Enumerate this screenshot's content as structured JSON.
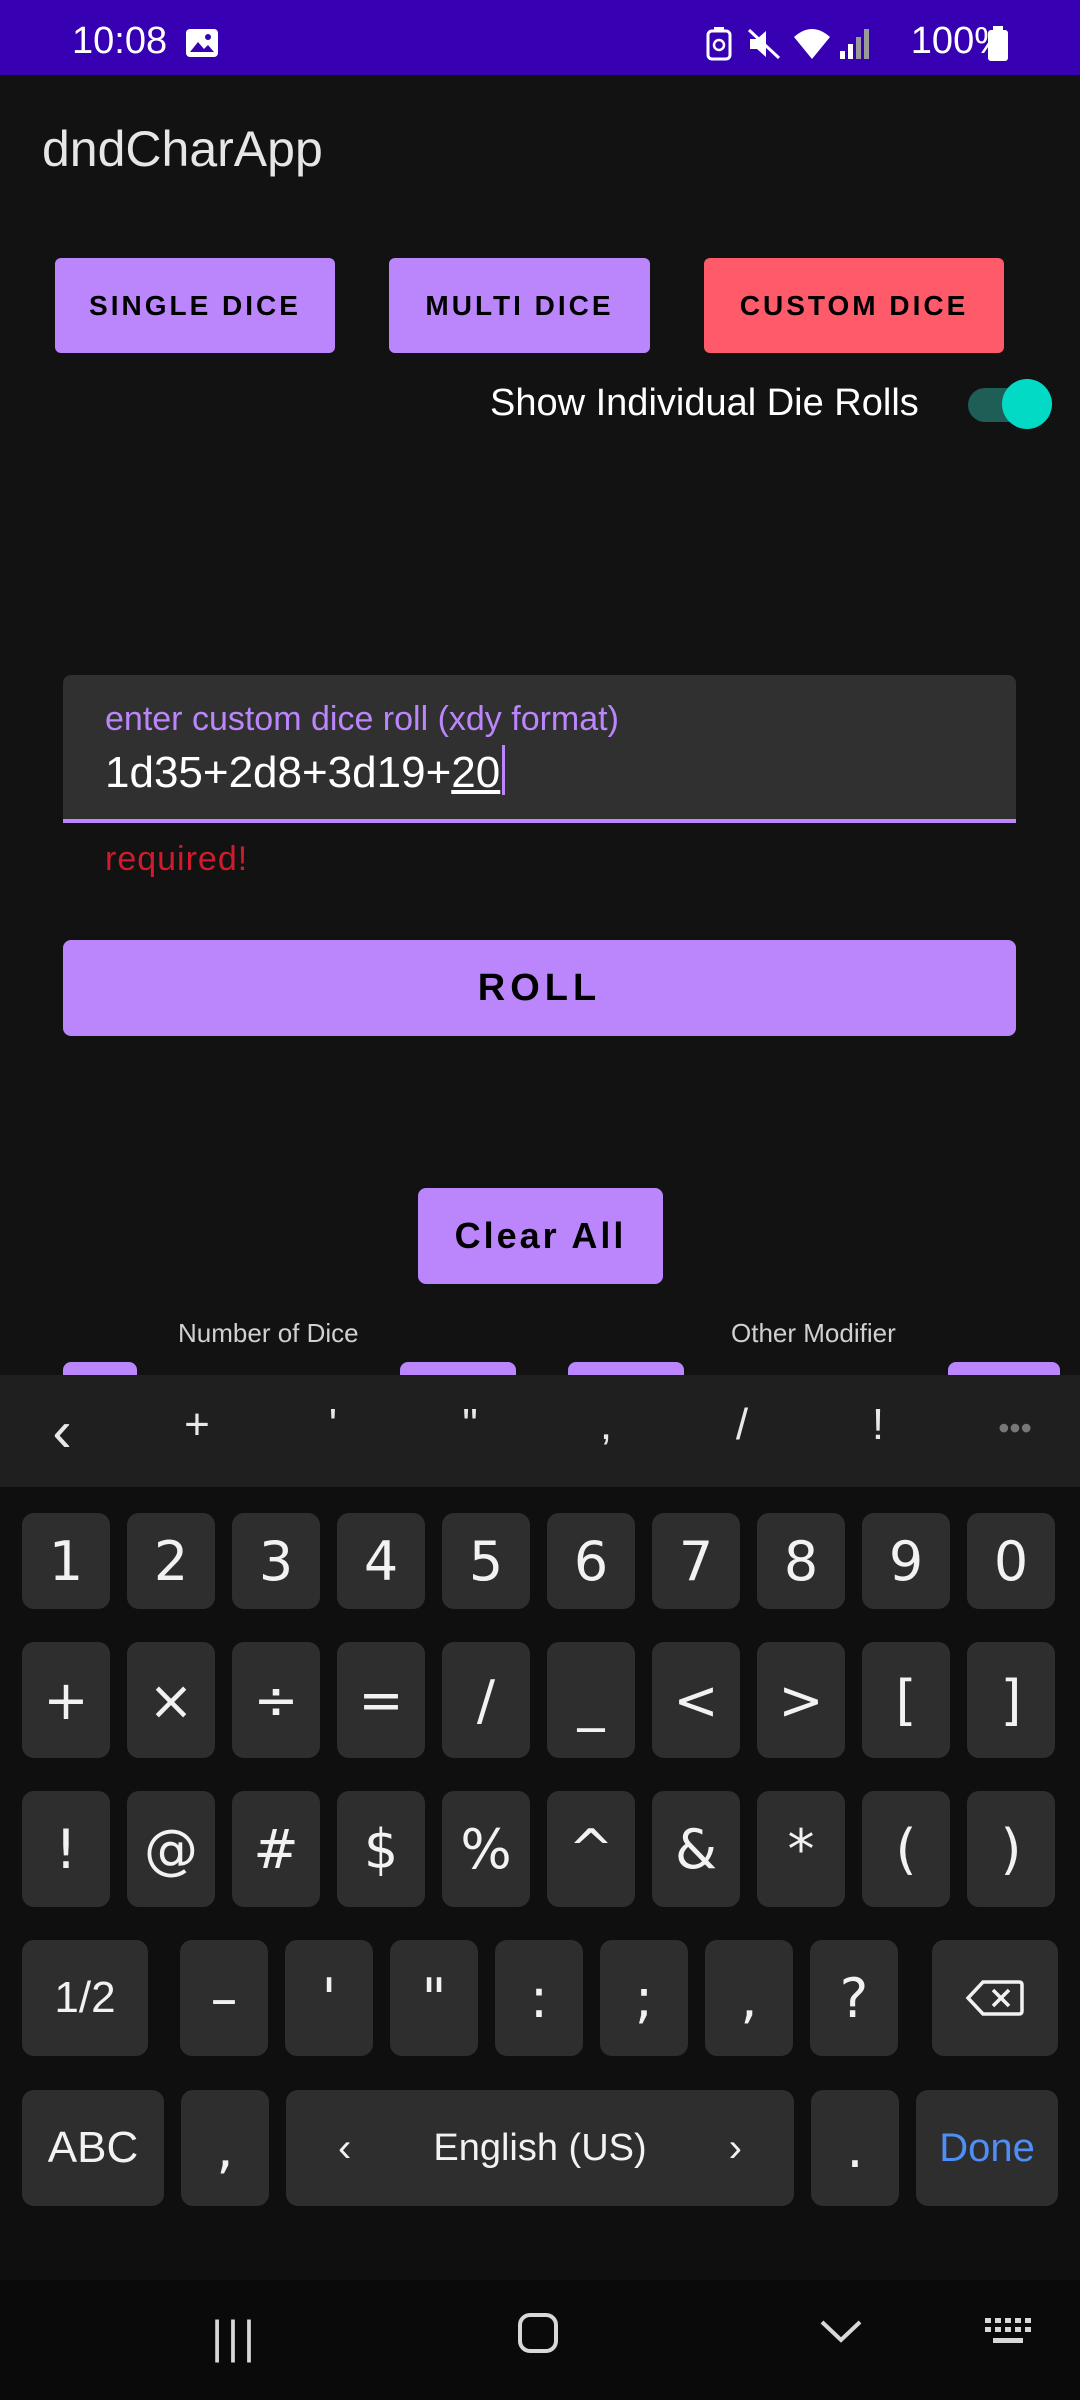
{
  "status_bar": {
    "time": "10:08",
    "battery": "100%",
    "icons": [
      "image-icon",
      "battery-saver-icon",
      "mute-icon",
      "wifi-icon",
      "signal-icon",
      "battery-icon"
    ]
  },
  "app": {
    "title": "dndCharApp"
  },
  "modes": {
    "single": "SINGLE DICE",
    "multi": "MULTI DICE",
    "custom": "CUSTOM DICE"
  },
  "toggle": {
    "label": "Show Individual Die Rolls",
    "on": true
  },
  "input": {
    "label": "enter custom dice roll (xdy format)",
    "value_prefix": "1d35+2d8+3d19+",
    "value_composing": "20",
    "error": "required!"
  },
  "actions": {
    "roll": "ROLL",
    "clear_all": "Clear All"
  },
  "labels": {
    "number_of_dice": "Number of Dice",
    "other_modifier": "Other Modifier"
  },
  "keyboard": {
    "suggestions": [
      "<",
      "+",
      "'",
      "\"",
      ",",
      "/",
      "!",
      "..."
    ],
    "row1": [
      "1",
      "2",
      "3",
      "4",
      "5",
      "6",
      "7",
      "8",
      "9",
      "0"
    ],
    "row2": [
      "+",
      "×",
      "÷",
      "=",
      "/",
      "_",
      "<",
      ">",
      "[",
      "]"
    ],
    "row3": [
      "!",
      "@",
      "#",
      "$",
      "%",
      "^",
      "&",
      "*",
      "(",
      ")"
    ],
    "row4": [
      "1/2",
      "–",
      "'",
      "\"",
      ":",
      ";",
      ",",
      "?"
    ],
    "row5": {
      "abc": "ABC",
      "comma": ",",
      "space": "English (US)",
      "period": ".",
      "done": "Done"
    }
  },
  "colors": {
    "primary": "#bb86fc",
    "accent": "#ff5a6a",
    "status_bar": "#3700b3",
    "switch": "#03dac5",
    "error": "#cf1b2b",
    "done": "#4f8ef7"
  }
}
